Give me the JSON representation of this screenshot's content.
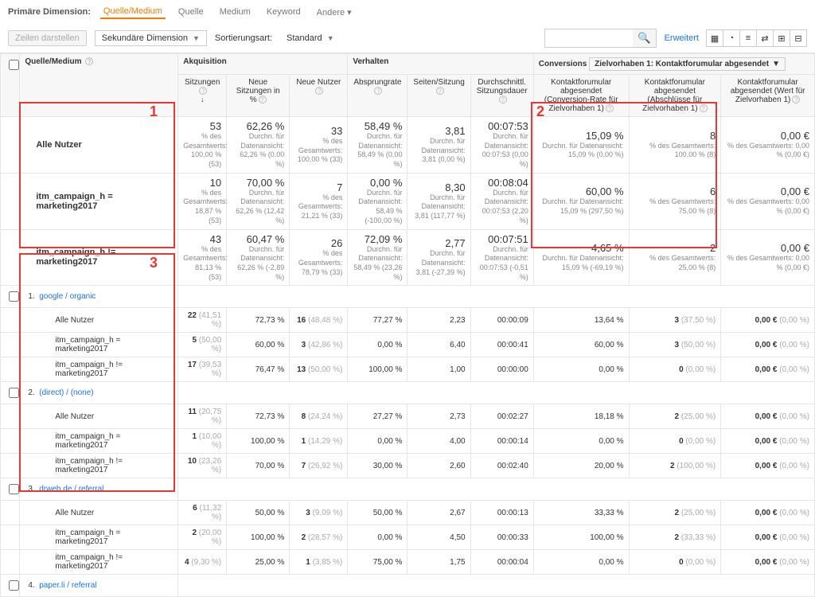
{
  "top": {
    "primary_dim": "Primäre Dimension:",
    "tabs": [
      "Quelle/Medium",
      "Quelle",
      "Medium",
      "Keyword",
      "Andere"
    ],
    "active_tab": "Quelle/Medium",
    "other_caret": "▾",
    "rows_btn": "Zeilen darstellen",
    "sec_dim": "Sekundäre Dimension",
    "sort_lbl": "Sortierungsart:",
    "sort_val": "Standard",
    "advanced": "Erweitert",
    "search_placeholder": ""
  },
  "groups": {
    "akq": "Akquisition",
    "verh": "Verhalten",
    "conv": "Conversions",
    "conv_sel": "Zielvorhaben 1: Kontaktforumular abgesendet"
  },
  "head": {
    "src": "Quelle/Medium",
    "c1": "Sitzungen",
    "c2": "Neue Sitzungen in %",
    "c3": "Neue Nutzer",
    "c4": "Absprungrate",
    "c5": "Seiten/Sitzung",
    "c6": "Durchschnittl. Sitzungsdauer",
    "c7": "Kontaktforumular abgesendet (Conversion-Rate für Zielvorhaben 1)",
    "c8": "Kontaktforumular abgesendet (Abschlüsse für Zielvorhaben 1)",
    "c9": "Kontaktforumular abgesendet (Wert für Zielvorhaben 1)"
  },
  "seg_hdr": [
    "Alle Nutzer",
    "itm_campaign_h = marketing2017",
    "itm_campaign_h != marketing2017"
  ],
  "summary": [
    {
      "c1": {
        "v": "53",
        "s": "% des Gesamtwerts: 100,00 % (53)"
      },
      "c2": {
        "v": "62,26 %",
        "s": "Durchn. für Datenansicht: 62,26 % (0,00 %)"
      },
      "c3": {
        "v": "33",
        "s": "% des Gesamtwerts: 100,00 % (33)"
      },
      "c4": {
        "v": "58,49 %",
        "s": "Durchn. für Datenansicht: 58,49 % (0,00 %)"
      },
      "c5": {
        "v": "3,81",
        "s": "Durchn. für Datenansicht: 3,81 (0,00 %)"
      },
      "c6": {
        "v": "00:07:53",
        "s": "Durchn. für Datenansicht: 00:07:53 (0,00 %)"
      },
      "c7": {
        "v": "15,09 %",
        "s": "Durchn. für Datenansicht: 15,09 % (0,00 %)"
      },
      "c8": {
        "v": "8",
        "s": "% des Gesamtwerts: 100,00 % (8)"
      },
      "c9": {
        "v": "0,00 €",
        "s": "% des Gesamtwerts: 0,00 % (0,00 €)"
      }
    },
    {
      "c1": {
        "v": "10",
        "s": "% des Gesamtwerts: 18,87 % (53)"
      },
      "c2": {
        "v": "70,00 %",
        "s": "Durchn. für Datenansicht: 62,26 % (12,42 %)"
      },
      "c3": {
        "v": "7",
        "s": "% des Gesamtwerts: 21,21 % (33)"
      },
      "c4": {
        "v": "0,00 %",
        "s": "Durchn. für Datenansicht: 58,49 % (-100,00 %)"
      },
      "c5": {
        "v": "8,30",
        "s": "Durchn. für Datenansicht: 3,81 (117,77 %)"
      },
      "c6": {
        "v": "00:08:04",
        "s": "Durchn. für Datenansicht: 00:07:53 (2,20 %)"
      },
      "c7": {
        "v": "60,00 %",
        "s": "Durchn. für Datenansicht: 15,09 % (297,50 %)"
      },
      "c8": {
        "v": "6",
        "s": "% des Gesamtwerts: 75,00 % (8)"
      },
      "c9": {
        "v": "0,00 €",
        "s": "% des Gesamtwerts: 0,00 % (0,00 €)"
      }
    },
    {
      "c1": {
        "v": "43",
        "s": "% des Gesamtwerts: 81,13 % (53)"
      },
      "c2": {
        "v": "60,47 %",
        "s": "Durchn. für Datenansicht: 62,26 % (-2,89 %)"
      },
      "c3": {
        "v": "26",
        "s": "% des Gesamtwerts: 78,79 % (33)"
      },
      "c4": {
        "v": "72,09 %",
        "s": "Durchn. für Datenansicht: 58,49 % (23,26 %)"
      },
      "c5": {
        "v": "2,77",
        "s": "Durchn. für Datenansicht: 3,81 (-27,39 %)"
      },
      "c6": {
        "v": "00:07:51",
        "s": "Durchn. für Datenansicht: 00:07:53 (-0,51 %)"
      },
      "c7": {
        "v": "4,65 %",
        "s": "Durchn. für Datenansicht: 15,09 % (-69,19 %)"
      },
      "c8": {
        "v": "2",
        "s": "% des Gesamtwerts: 25,00 % (8)"
      },
      "c9": {
        "v": "0,00 €",
        "s": "% des Gesamtwerts: 0,00 % (0,00 €)"
      }
    }
  ],
  "dims": [
    {
      "n": "1.",
      "label": "google / organic",
      "rows": [
        {
          "c1": [
            "22",
            "(41,51 %)"
          ],
          "c2": "72,73 %",
          "c3": [
            "16",
            "(48,48 %)"
          ],
          "c4": "77,27 %",
          "c5": "2,23",
          "c6": "00:00:09",
          "c7": "13,64 %",
          "c8": [
            "3",
            "(37,50 %)"
          ],
          "c9": [
            "0,00 €",
            "(0,00 %)"
          ]
        },
        {
          "c1": [
            "5",
            "(50,00 %)"
          ],
          "c2": "60,00 %",
          "c3": [
            "3",
            "(42,86 %)"
          ],
          "c4": "0,00 %",
          "c5": "6,40",
          "c6": "00:00:41",
          "c7": "60,00 %",
          "c8": [
            "3",
            "(50,00 %)"
          ],
          "c9": [
            "0,00 €",
            "(0,00 %)"
          ]
        },
        {
          "c1": [
            "17",
            "(39,53 %)"
          ],
          "c2": "76,47 %",
          "c3": [
            "13",
            "(50,00 %)"
          ],
          "c4": "100,00 %",
          "c5": "1,00",
          "c6": "00:00:00",
          "c7": "0,00 %",
          "c8": [
            "0",
            "(0,00 %)"
          ],
          "c9": [
            "0,00 €",
            "(0,00 %)"
          ]
        }
      ]
    },
    {
      "n": "2.",
      "label": "(direct) / (none)",
      "rows": [
        {
          "c1": [
            "11",
            "(20,75 %)"
          ],
          "c2": "72,73 %",
          "c3": [
            "8",
            "(24,24 %)"
          ],
          "c4": "27,27 %",
          "c5": "2,73",
          "c6": "00:02:27",
          "c7": "18,18 %",
          "c8": [
            "2",
            "(25,00 %)"
          ],
          "c9": [
            "0,00 €",
            "(0,00 %)"
          ]
        },
        {
          "c1": [
            "1",
            "(10,00 %)"
          ],
          "c2": "100,00 %",
          "c3": [
            "1",
            "(14,29 %)"
          ],
          "c4": "0,00 %",
          "c5": "4,00",
          "c6": "00:00:14",
          "c7": "0,00 %",
          "c8": [
            "0",
            "(0,00 %)"
          ],
          "c9": [
            "0,00 €",
            "(0,00 %)"
          ]
        },
        {
          "c1": [
            "10",
            "(23,26 %)"
          ],
          "c2": "70,00 %",
          "c3": [
            "7",
            "(26,92 %)"
          ],
          "c4": "30,00 %",
          "c5": "2,60",
          "c6": "00:02:40",
          "c7": "20,00 %",
          "c8": [
            "2",
            "(100,00 %)"
          ],
          "c9": [
            "0,00 €",
            "(0,00 %)"
          ]
        }
      ]
    },
    {
      "n": "3.",
      "label": "drweb.de / referral",
      "rows": [
        {
          "c1": [
            "6",
            "(11,32 %)"
          ],
          "c2": "50,00 %",
          "c3": [
            "3",
            "(9,09 %)"
          ],
          "c4": "50,00 %",
          "c5": "2,67",
          "c6": "00:00:13",
          "c7": "33,33 %",
          "c8": [
            "2",
            "(25,00 %)"
          ],
          "c9": [
            "0,00 €",
            "(0,00 %)"
          ]
        },
        {
          "c1": [
            "2",
            "(20,00 %)"
          ],
          "c2": "100,00 %",
          "c3": [
            "2",
            "(28,57 %)"
          ],
          "c4": "0,00 %",
          "c5": "4,50",
          "c6": "00:00:33",
          "c7": "100,00 %",
          "c8": [
            "2",
            "(33,33 %)"
          ],
          "c9": [
            "0,00 €",
            "(0,00 %)"
          ]
        },
        {
          "c1": [
            "4",
            "(9,30 %)"
          ],
          "c2": "25,00 %",
          "c3": [
            "1",
            "(3,85 %)"
          ],
          "c4": "75,00 %",
          "c5": "1,75",
          "c6": "00:00:04",
          "c7": "0,00 %",
          "c8": [
            "0",
            "(0,00 %)"
          ],
          "c9": [
            "0,00 €",
            "(0,00 %)"
          ]
        }
      ]
    },
    {
      "n": "4.",
      "label": "paper.li / referral",
      "rows": []
    }
  ]
}
